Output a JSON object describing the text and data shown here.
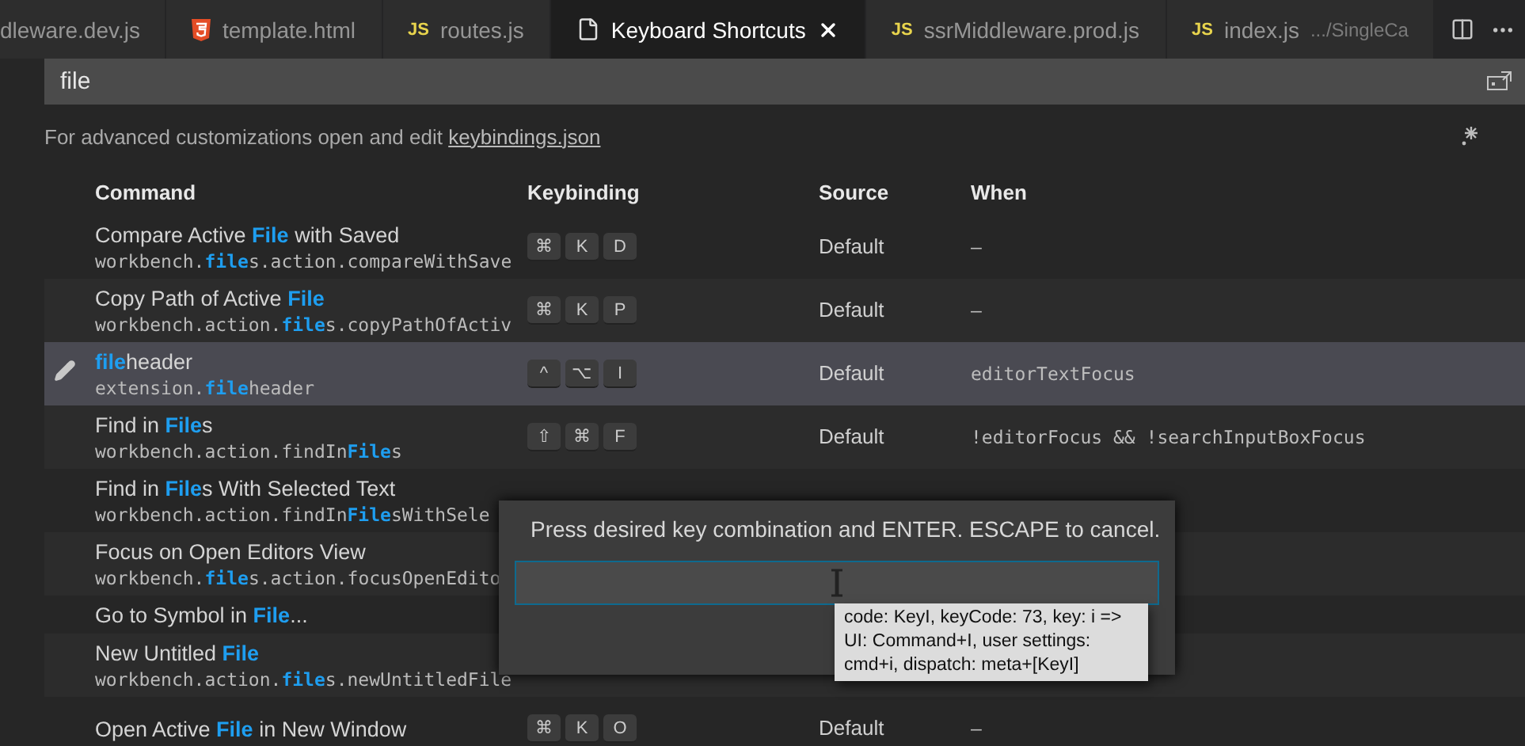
{
  "tabs": [
    {
      "label": "dleware.dev.js",
      "kind": "plain",
      "selected": false
    },
    {
      "label": "template.html",
      "kind": "html",
      "selected": false
    },
    {
      "label": "routes.js",
      "kind": "js",
      "badge": "JS",
      "selected": false
    },
    {
      "label": "Keyboard Shortcuts",
      "kind": "file",
      "selected": true
    },
    {
      "label": "ssrMiddleware.prod.js",
      "kind": "js",
      "badge": "JS",
      "selected": false
    },
    {
      "label": "index.js",
      "kind": "js",
      "badge": "JS",
      "selected": false,
      "description": ".../SingleCa"
    }
  ],
  "search": {
    "value": "file"
  },
  "info": {
    "text": "For advanced customizations open and edit ",
    "link": "keybindings.json"
  },
  "columns": [
    "Command",
    "Keybinding",
    "Source",
    "When"
  ],
  "rows": [
    {
      "selected": false,
      "kind": "double",
      "label": [
        {
          "text": "Compare Active "
        },
        {
          "text": "File",
          "match": true
        },
        {
          "text": " with Saved"
        }
      ],
      "id": [
        {
          "text": "workbench."
        },
        {
          "text": "file",
          "match": true
        },
        {
          "text": "s.action.compareWithSave"
        }
      ],
      "keys": [
        "⌘",
        "K",
        "D"
      ],
      "source": "Default",
      "when": "—"
    },
    {
      "selected": false,
      "kind": "double",
      "label": [
        {
          "text": "Copy Path of Active "
        },
        {
          "text": "File",
          "match": true
        }
      ],
      "id": [
        {
          "text": "workbench.action."
        },
        {
          "text": "file",
          "match": true
        },
        {
          "text": "s.copyPathOfActiv"
        }
      ],
      "keys": [
        "⌘",
        "K",
        "P"
      ],
      "source": "Default",
      "when": "—"
    },
    {
      "selected": true,
      "kind": "double",
      "label": [
        {
          "text": "file",
          "match": true
        },
        {
          "text": "header"
        }
      ],
      "id": [
        {
          "text": "extension."
        },
        {
          "text": "file",
          "match": true
        },
        {
          "text": "header"
        }
      ],
      "keys": [
        "^",
        "⌥",
        "I"
      ],
      "source": "Default",
      "when": "editorTextFocus"
    },
    {
      "selected": false,
      "kind": "double",
      "label": [
        {
          "text": "Find in "
        },
        {
          "text": "File",
          "match": true
        },
        {
          "text": "s"
        }
      ],
      "id": [
        {
          "text": "workbench.action.findIn"
        },
        {
          "text": "File",
          "match": true
        },
        {
          "text": "s"
        }
      ],
      "keys": [
        "⇧",
        "⌘",
        "F"
      ],
      "source": "Default",
      "when": "!editorFocus && !searchInputBoxFocus"
    },
    {
      "selected": false,
      "label": [
        {
          "text": "Find in "
        },
        {
          "text": "File",
          "match": true
        },
        {
          "text": "s With Selected Text"
        }
      ],
      "id": [
        {
          "text": "workbench.action.findIn"
        },
        {
          "text": "File",
          "match": true
        },
        {
          "text": "sWithSele"
        }
      ],
      "kind": "double"
    },
    {
      "selected": false,
      "kind": "double",
      "label": [
        {
          "text": "Focus on Open Editors View"
        }
      ],
      "id": [
        {
          "text": "workbench."
        },
        {
          "text": "file",
          "match": true
        },
        {
          "text": "s.action.focusOpenEdito"
        }
      ]
    },
    {
      "selected": false,
      "kind": "single",
      "label": [
        {
          "text": "Go to Symbol in "
        },
        {
          "text": "File",
          "match": true
        },
        {
          "text": "..."
        }
      ]
    },
    {
      "selected": false,
      "kind": "double",
      "label": [
        {
          "text": "New Untitled "
        },
        {
          "text": "File",
          "match": true
        }
      ],
      "id": [
        {
          "text": "workbench.action."
        },
        {
          "text": "file",
          "match": true
        },
        {
          "text": "s.newUntitledFile"
        }
      ]
    },
    {
      "selected": false,
      "kind": "double",
      "label": [
        {
          "text": "Open Active "
        },
        {
          "text": "File",
          "match": true
        },
        {
          "text": " in New Window"
        }
      ],
      "keys": [
        "⌘",
        "K",
        "O"
      ],
      "source": "Default",
      "when": "—"
    }
  ],
  "dialog": {
    "prompt": "Press desired key combination and ENTER. ESCAPE to cancel.",
    "tooltip": "code: KeyI, keyCode: 73, key: i => UI: Command+I, user settings: cmd+i, dispatch: meta+[KeyI]"
  }
}
